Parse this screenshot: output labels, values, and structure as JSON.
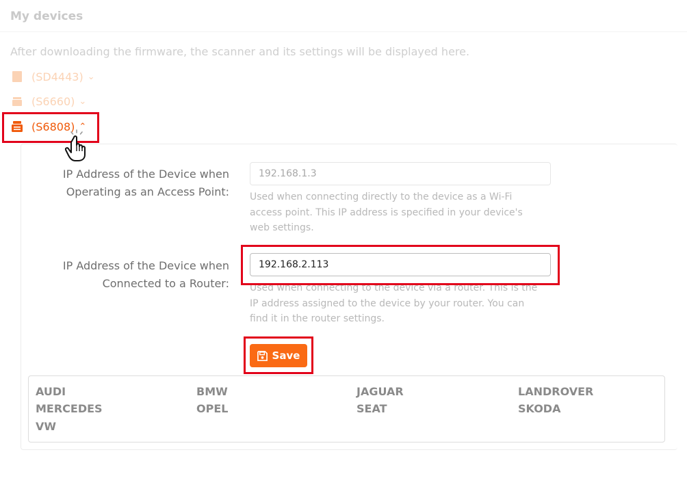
{
  "header": {
    "title": "My devices"
  },
  "hint": "After downloading the firmware, the scanner and its settings will be displayed here.",
  "devices": [
    {
      "label": "(SD4443)",
      "chevron": "chevron-down-icon",
      "expanded": false
    },
    {
      "label": "(S6660)",
      "chevron": "chevron-down-icon",
      "expanded": false
    },
    {
      "label": "(S6808)",
      "chevron": "chevron-up-icon",
      "expanded": true
    }
  ],
  "settings": {
    "ap_ip": {
      "label_line1": "IP Address of the Device when",
      "label_line2": "Operating as an Access Point:",
      "value": "192.168.1.3",
      "help_line1": "Used when connecting directly to the device as a Wi-Fi",
      "help_line2": "access point. This IP address is specified in your device's",
      "help_line3": "web settings."
    },
    "router_ip": {
      "label_line1": "IP Address of the Device when",
      "label_line2": "Connected to a Router:",
      "value": "192.168.2.113",
      "help_line1": "Used when connecting to the device via a router. This is the",
      "help_line2": "IP address assigned to the device by your router. You can",
      "help_line3": "find it in the router settings."
    },
    "save_label": "Save"
  },
  "brands": [
    "AUDI",
    "BMW",
    "JAGUAR",
    "LANDROVER",
    "MERCEDES",
    "OPEL",
    "SEAT",
    "SKODA",
    "VW"
  ],
  "colors": {
    "accent": "#fa6a14",
    "active_text": "#f05a0a",
    "highlight": "#e2001a"
  }
}
